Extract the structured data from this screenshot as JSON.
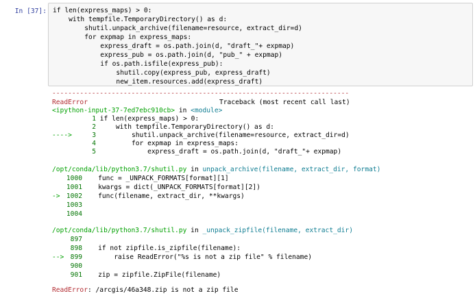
{
  "cell": {
    "prompt": "In [37]:",
    "code_lines": [
      "if len(express_maps) > 0:",
      "    with tempfile.TemporaryDirectory() as d:",
      "        shutil.unpack_archive(filename=resource, extract_dir=d)",
      "        for expmap in express_maps:",
      "            express_draft = os.path.join(d, \"draft_\"+ expmap)",
      "            express_pub = os.path.join(d, \"pub_\" + expmap)",
      "            if os.path.isfile(express_pub):",
      "                shutil.copy(express_pub, express_draft)",
      "                new_item.resources.add(express_draft)"
    ]
  },
  "traceback": {
    "separator": "---------------------------------------------------------------------------",
    "error_type": "ReadError",
    "header_right": "Traceback (most recent call last)",
    "frame1": {
      "location": "<ipython-input-37-7ed7ebc910cb>",
      "in_text": " in ",
      "func": "<module>",
      "lines": [
        {
          "arrow": "",
          "num": "1",
          "code": "if len(express_maps) > 0:"
        },
        {
          "arrow": "",
          "num": "2",
          "code": "    with tempfile.TemporaryDirectory() as d:"
        },
        {
          "arrow": "---->",
          "num": "3",
          "code": "        shutil.unpack_archive(filename=resource, extract_dir=d)"
        },
        {
          "arrow": "",
          "num": "4",
          "code": "        for expmap in express_maps:"
        },
        {
          "arrow": "",
          "num": "5",
          "code": "            express_draft = os.path.join(d, \"draft_\"+ expmap)"
        }
      ]
    },
    "frame2": {
      "location": "/opt/conda/lib/python3.7/shutil.py",
      "in_text": " in ",
      "func": "unpack_archive(filename, extract_dir, format)",
      "lines": [
        {
          "arrow": "",
          "num": "1000",
          "code": "    func = _UNPACK_FORMATS[format][1]"
        },
        {
          "arrow": "",
          "num": "1001",
          "code": "    kwargs = dict(_UNPACK_FORMATS[format][2])"
        },
        {
          "arrow": "->",
          "num": "1002",
          "code": "    func(filename, extract_dir, **kwargs)"
        },
        {
          "arrow": "",
          "num": "1003",
          "code": ""
        },
        {
          "arrow": "",
          "num": "1004",
          "code": ""
        }
      ]
    },
    "frame3": {
      "location": "/opt/conda/lib/python3.7/shutil.py",
      "in_text": " in ",
      "func": "_unpack_zipfile(filename, extract_dir)",
      "lines": [
        {
          "arrow": "",
          "num": "897",
          "code": ""
        },
        {
          "arrow": "",
          "num": "898",
          "code": "    if not zipfile.is_zipfile(filename):"
        },
        {
          "arrow": "-->",
          "num": "899",
          "code": "        raise ReadError(\"%s is not a zip file\" % filename)"
        },
        {
          "arrow": "",
          "num": "900",
          "code": ""
        },
        {
          "arrow": "",
          "num": "901",
          "code": "    zip = zipfile.ZipFile(filename)"
        }
      ]
    },
    "final_type": "ReadError",
    "final_message": ": /arcgis/46a348.zip is not a zip file"
  }
}
